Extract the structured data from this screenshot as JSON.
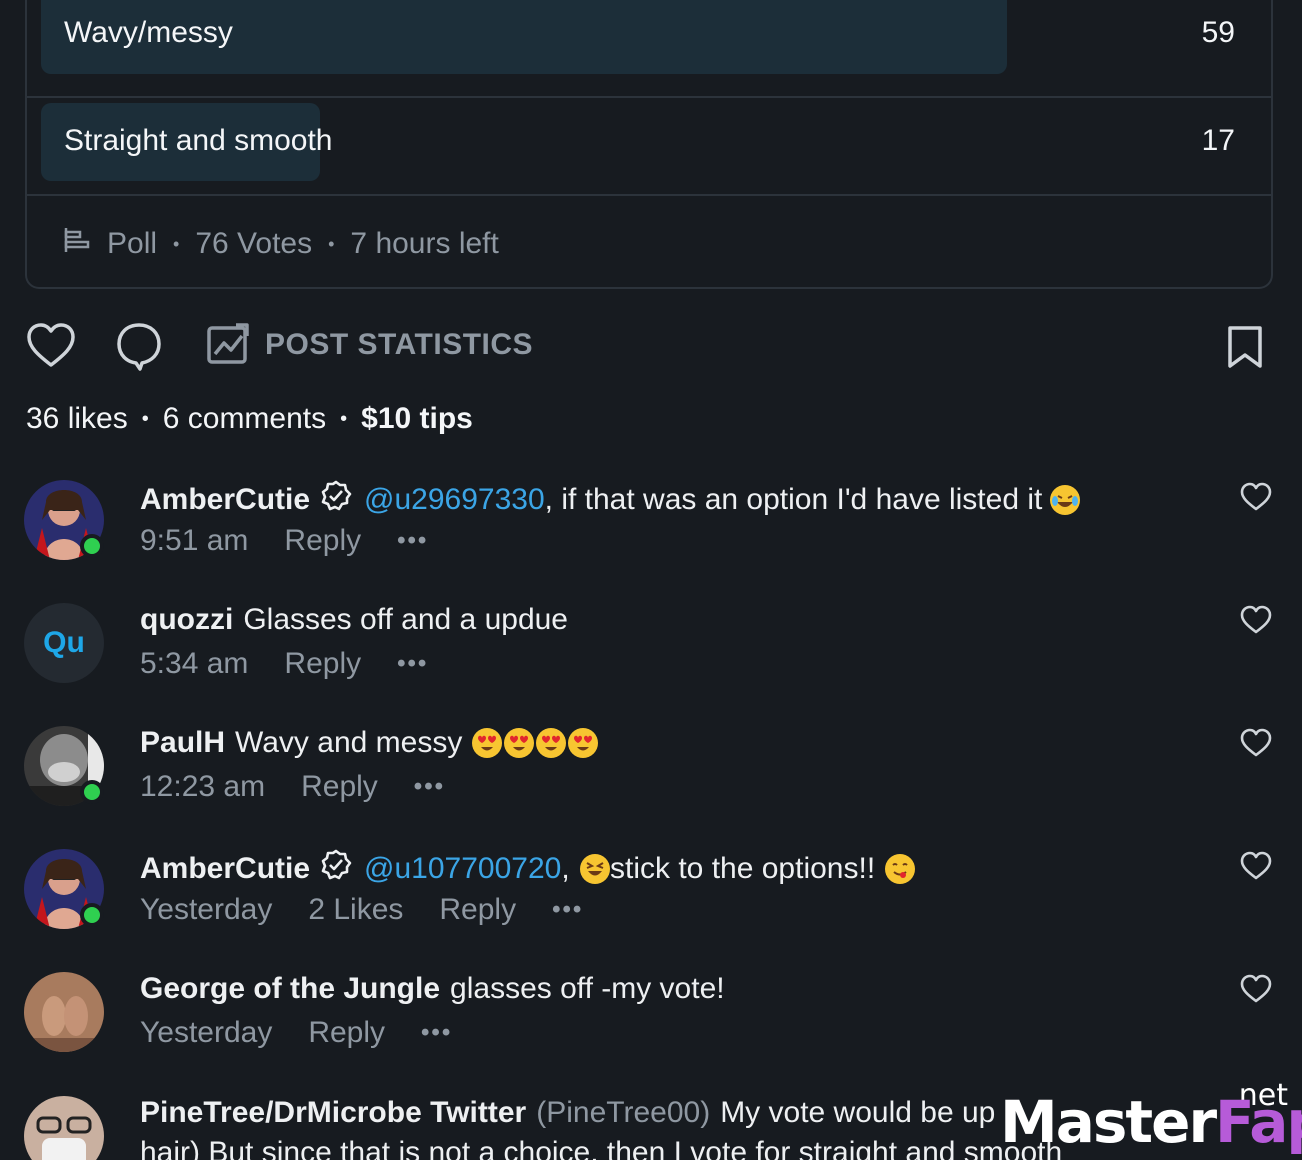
{
  "poll": {
    "options": [
      {
        "label": "Wavy/messy",
        "count": "59"
      },
      {
        "label": "Straight and smooth",
        "count": "17"
      }
    ],
    "footer": {
      "type": "Poll",
      "votes": "76 Votes",
      "time_left": "7 hours left"
    }
  },
  "actions": {
    "stats_label": "POST STATISTICS"
  },
  "summary": {
    "likes": "36 likes",
    "comments": "6 comments",
    "tips": "$10 tips"
  },
  "comments": [
    {
      "author": "AmberCutie",
      "mention": "@u29697330",
      "text": ", if that was an option I'd have listed it",
      "time": "9:51 am",
      "reply": "Reply",
      "more": "•••"
    },
    {
      "author": "quozzi",
      "initials": "Qu",
      "text": "Glasses off and a updue",
      "time": "5:34 am",
      "reply": "Reply",
      "more": "•••"
    },
    {
      "author": "PaulH",
      "text": "Wavy and messy",
      "time": "12:23 am",
      "reply": "Reply",
      "more": "•••"
    },
    {
      "author": "AmberCutie",
      "mention": "@u107700720",
      "text": ", ",
      "text2": "stick to the options!!",
      "time": "Yesterday",
      "likes": "2 Likes",
      "reply": "Reply",
      "more": "•••"
    },
    {
      "author": "George of the Jungle",
      "text": "glasses off -my vote!",
      "time": "Yesterday",
      "reply": "Reply",
      "more": "•••"
    },
    {
      "author": "PineTree/DrMicrobe Twitter",
      "handle": "(PineTree00)",
      "text": "My vote would be up",
      "text_line2": "hair) But since that is not a choice, then I vote for straight and smooth"
    }
  ],
  "watermark": {
    "main": "Master",
    "accent": "Fap",
    "tld": ".net"
  },
  "colors": {
    "background": "#171b20",
    "accent_blue": "#3ba5e6",
    "muted": "#8f98a2",
    "poll_bar": "#1c2e39",
    "online": "#2fd050"
  }
}
